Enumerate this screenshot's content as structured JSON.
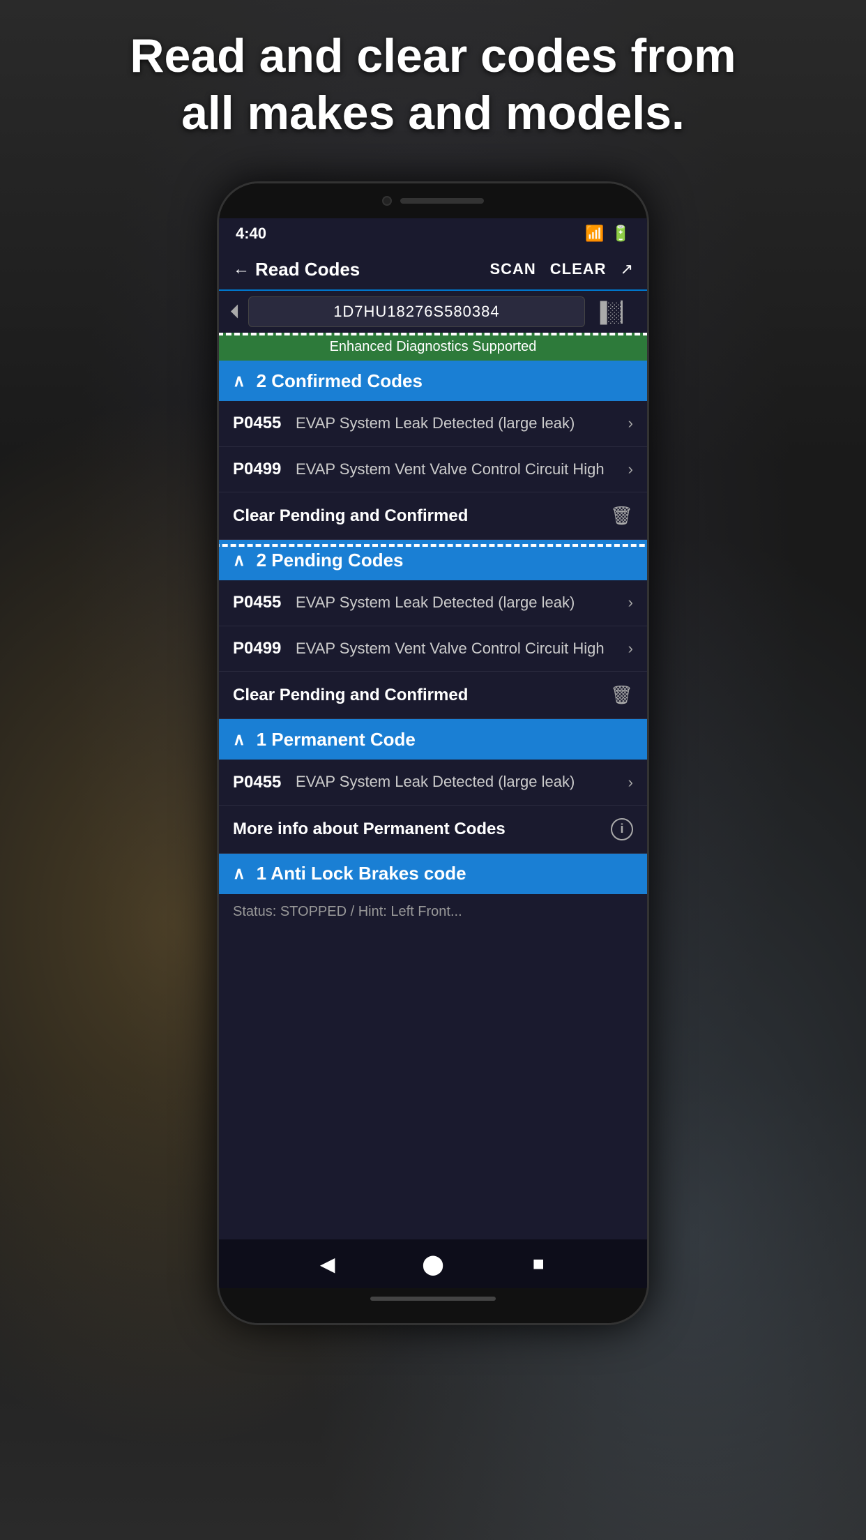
{
  "header": {
    "title_line1": "Read and clear codes from",
    "title_line2": "all makes and models."
  },
  "status_bar": {
    "time": "4:40",
    "wifi": "▲",
    "battery": "▮"
  },
  "nav": {
    "back_label": "Read Codes",
    "scan_label": "SCAN",
    "clear_label": "CLEAR"
  },
  "vin": {
    "value": "1D7HU18276S580384"
  },
  "enhanced_badge": {
    "label": "Enhanced Diagnostics Supported"
  },
  "sections": [
    {
      "id": "confirmed",
      "title": "2 Confirmed Codes",
      "codes": [
        {
          "id": "P0455",
          "desc": "EVAP System Leak Detected (large leak)"
        },
        {
          "id": "P0499",
          "desc": "EVAP System Vent Valve Control Circuit High"
        }
      ],
      "clear_label": "Clear Pending and Confirmed",
      "has_clear": true,
      "has_info": false
    },
    {
      "id": "pending",
      "title": "2 Pending Codes",
      "codes": [
        {
          "id": "P0455",
          "desc": "EVAP System Leak Detected (large leak)"
        },
        {
          "id": "P0499",
          "desc": "EVAP System Vent Valve Control Circuit High"
        }
      ],
      "clear_label": "Clear Pending and Confirmed",
      "has_clear": true,
      "has_info": false
    },
    {
      "id": "permanent",
      "title": "1 Permanent Code",
      "codes": [
        {
          "id": "P0455",
          "desc": "EVAP System Leak Detected (large leak)"
        }
      ],
      "clear_label": "More info about Permanent Codes",
      "has_clear": false,
      "has_info": true
    },
    {
      "id": "abs",
      "title": "1 Anti Lock Brakes code",
      "codes": [],
      "clear_label": "",
      "has_clear": false,
      "has_info": false
    }
  ],
  "partial_row_text": "Status: STOPPED / Hint: Left Front...",
  "bottom_nav": {
    "back": "◀",
    "home": "⬤",
    "square": "■"
  }
}
